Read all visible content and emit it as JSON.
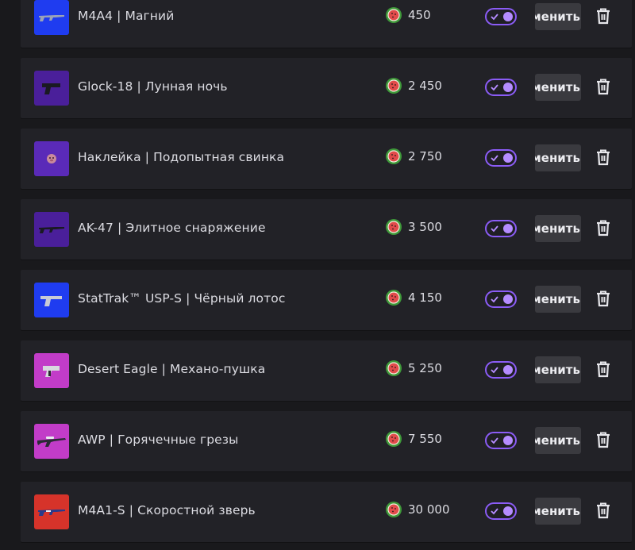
{
  "currency_icon": "watermelon-icon",
  "toggle_color": "#8b5cf6",
  "items": [
    {
      "name": "M4A4 | Магний",
      "price": "450",
      "enabled": true,
      "thumb_color": "#1f3cf0",
      "item_icon": "rifle-icon",
      "edit_label": "Изменить"
    },
    {
      "name": "Glock-18 | Лунная ночь",
      "price": "2 450",
      "enabled": true,
      "thumb_color": "#4a1f9a",
      "item_icon": "pistol-icon",
      "edit_label": "Изменить"
    },
    {
      "name": "Наклейка | Подопытная свинка",
      "price": "2 750",
      "enabled": true,
      "thumb_color": "#5a2ab8",
      "item_icon": "sticker-icon",
      "edit_label": "Изменить"
    },
    {
      "name": "AK-47 | Элитное снаряжение",
      "price": "3 500",
      "enabled": true,
      "thumb_color": "#4a1f9a",
      "item_icon": "rifle-icon",
      "edit_label": "Изменить"
    },
    {
      "name": "StatTrak™ USP-S | Чёрный лотос",
      "price": "4 150",
      "enabled": true,
      "thumb_color": "#1f3cf0",
      "item_icon": "pistol-icon",
      "edit_label": "Изменить"
    },
    {
      "name": "Desert Eagle | Механо-пушка",
      "price": "5 250",
      "enabled": true,
      "thumb_color": "#c23cc8",
      "item_icon": "pistol-icon",
      "edit_label": "Изменить"
    },
    {
      "name": "AWP | Горячечные грезы",
      "price": "7 550",
      "enabled": true,
      "thumb_color": "#c23cc8",
      "item_icon": "sniper-rifle-icon",
      "edit_label": "Изменить"
    },
    {
      "name": "M4A1-S | Скоростной зверь",
      "price": "30 000",
      "enabled": true,
      "thumb_color": "#d6332a",
      "item_icon": "rifle-icon",
      "edit_label": "Изменить"
    }
  ]
}
